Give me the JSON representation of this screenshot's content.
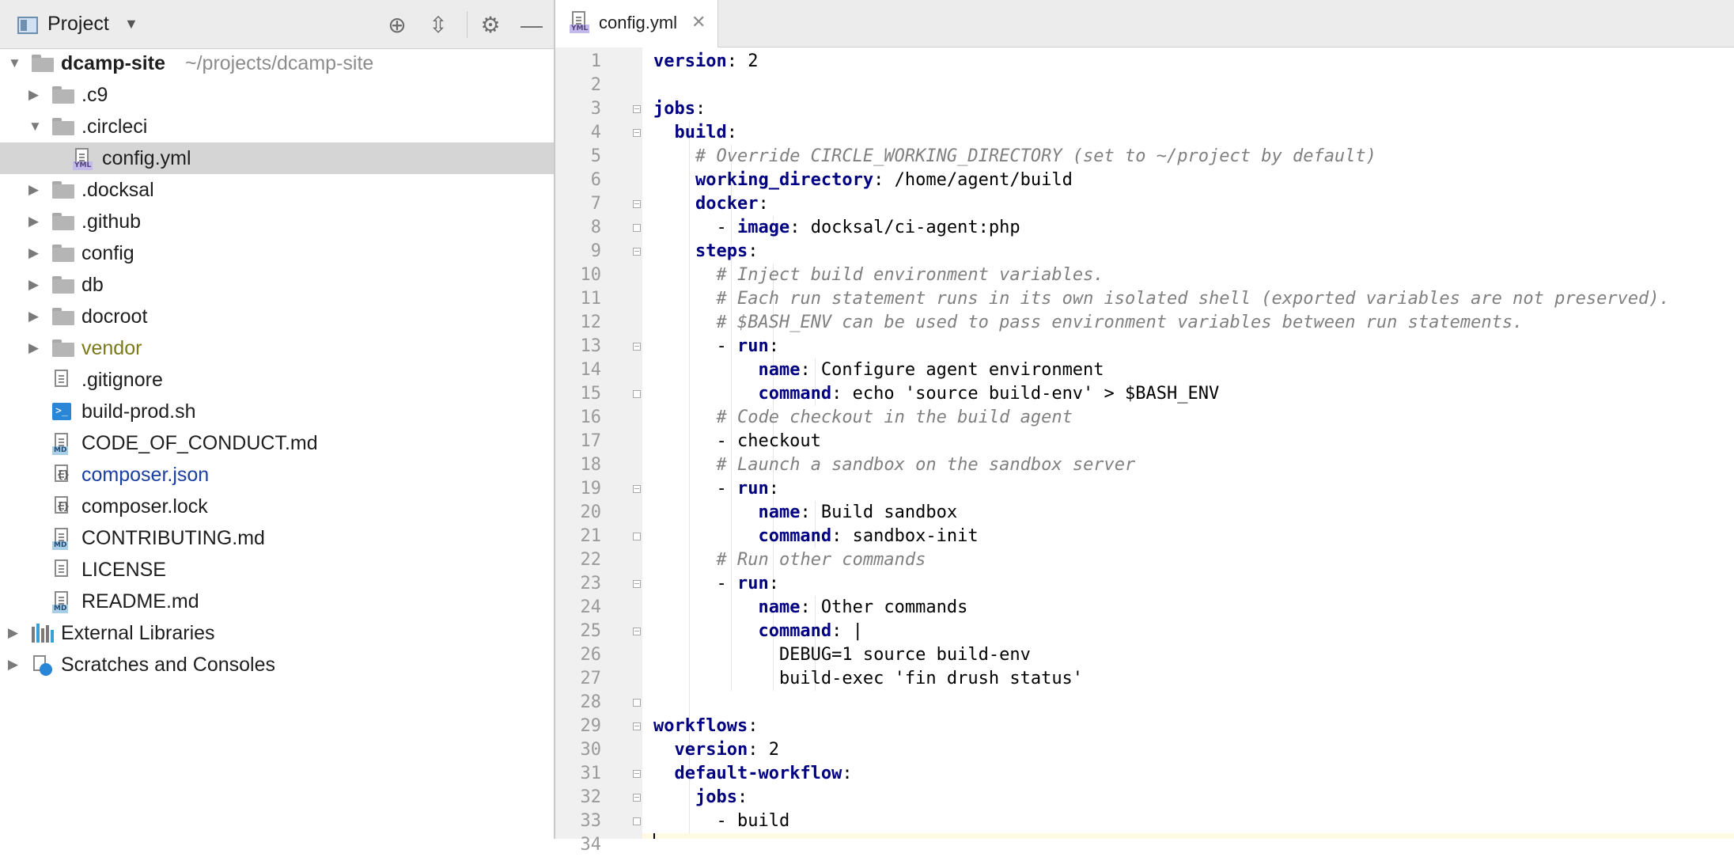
{
  "project_panel": {
    "title": "Project",
    "dropdown": "▼",
    "tools": [
      {
        "name": "locate-icon",
        "glyph": "⊕"
      },
      {
        "name": "collapse-all-icon",
        "glyph": "⇳"
      },
      {
        "name": "gear-icon",
        "glyph": "⚙"
      },
      {
        "name": "minimize-icon",
        "glyph": "—"
      }
    ],
    "tree": [
      {
        "label": "dcamp-site",
        "path": "~/projects/dcamp-site",
        "indent": 0,
        "kind": "folder",
        "arrow": "▼",
        "style": "bold"
      },
      {
        "label": ".c9",
        "indent": 1,
        "kind": "folder",
        "arrow": "▶"
      },
      {
        "label": ".circleci",
        "indent": 1,
        "kind": "folder",
        "arrow": "▼"
      },
      {
        "label": "config.yml",
        "indent": 2,
        "kind": "yml",
        "selected": true
      },
      {
        "label": ".docksal",
        "indent": 1,
        "kind": "folder",
        "arrow": "▶"
      },
      {
        "label": ".github",
        "indent": 1,
        "kind": "folder",
        "arrow": "▶"
      },
      {
        "label": "config",
        "indent": 1,
        "kind": "folder",
        "arrow": "▶"
      },
      {
        "label": "db",
        "indent": 1,
        "kind": "folder",
        "arrow": "▶"
      },
      {
        "label": "docroot",
        "indent": 1,
        "kind": "folder",
        "arrow": "▶"
      },
      {
        "label": "vendor",
        "indent": 1,
        "kind": "folder",
        "arrow": "▶",
        "style": "vendor"
      },
      {
        "label": ".gitignore",
        "indent": 1,
        "kind": "text"
      },
      {
        "label": "build-prod.sh",
        "indent": 1,
        "kind": "shell"
      },
      {
        "label": "CODE_OF_CONDUCT.md",
        "indent": 1,
        "kind": "md"
      },
      {
        "label": "composer.json",
        "indent": 1,
        "kind": "json",
        "style": "link"
      },
      {
        "label": "composer.lock",
        "indent": 1,
        "kind": "json"
      },
      {
        "label": "CONTRIBUTING.md",
        "indent": 1,
        "kind": "md"
      },
      {
        "label": "LICENSE",
        "indent": 1,
        "kind": "text"
      },
      {
        "label": "README.md",
        "indent": 1,
        "kind": "md"
      },
      {
        "label": "External Libraries",
        "indent": 0,
        "kind": "libraries",
        "arrow": "▶"
      },
      {
        "label": "Scratches and Consoles",
        "indent": 0,
        "kind": "scratches",
        "arrow": "▶"
      }
    ]
  },
  "editor": {
    "tab": {
      "label": "config.yml",
      "close": "✕",
      "icon_tag": "YML"
    },
    "lines": [
      [
        [
          "k",
          "version"
        ],
        [
          "t",
          ": 2"
        ]
      ],
      [],
      [
        [
          "k",
          "jobs"
        ],
        [
          "t",
          ":"
        ]
      ],
      [
        [
          "t",
          "  "
        ],
        [
          "k",
          "build"
        ],
        [
          "t",
          ":"
        ]
      ],
      [
        [
          "t",
          "    "
        ],
        [
          "c",
          "# Override CIRCLE_WORKING_DIRECTORY (set to ~/project by default)"
        ]
      ],
      [
        [
          "t",
          "    "
        ],
        [
          "k",
          "working_directory"
        ],
        [
          "t",
          ": /home/agent/build"
        ]
      ],
      [
        [
          "t",
          "    "
        ],
        [
          "k",
          "docker"
        ],
        [
          "t",
          ":"
        ]
      ],
      [
        [
          "t",
          "      - "
        ],
        [
          "k",
          "image"
        ],
        [
          "t",
          ": docksal/ci-agent:php"
        ]
      ],
      [
        [
          "t",
          "    "
        ],
        [
          "k",
          "steps"
        ],
        [
          "t",
          ":"
        ]
      ],
      [
        [
          "t",
          "      "
        ],
        [
          "c",
          "# Inject build environment variables."
        ]
      ],
      [
        [
          "t",
          "      "
        ],
        [
          "c",
          "# Each run statement runs in its own isolated shell (exported variables are not preserved)."
        ]
      ],
      [
        [
          "t",
          "      "
        ],
        [
          "c",
          "# $BASH_ENV can be used to pass environment variables between run statements."
        ]
      ],
      [
        [
          "t",
          "      - "
        ],
        [
          "k",
          "run"
        ],
        [
          "t",
          ":"
        ]
      ],
      [
        [
          "t",
          "          "
        ],
        [
          "k",
          "name"
        ],
        [
          "t",
          ": Configure agent environment"
        ]
      ],
      [
        [
          "t",
          "          "
        ],
        [
          "k",
          "command"
        ],
        [
          "t",
          ": echo 'source build-env' > $BASH_ENV"
        ]
      ],
      [
        [
          "t",
          "      "
        ],
        [
          "c",
          "# Code checkout in the build agent"
        ]
      ],
      [
        [
          "t",
          "      - checkout"
        ]
      ],
      [
        [
          "t",
          "      "
        ],
        [
          "c",
          "# Launch a sandbox on the sandbox server"
        ]
      ],
      [
        [
          "t",
          "      - "
        ],
        [
          "k",
          "run"
        ],
        [
          "t",
          ":"
        ]
      ],
      [
        [
          "t",
          "          "
        ],
        [
          "k",
          "name"
        ],
        [
          "t",
          ": Build sandbox"
        ]
      ],
      [
        [
          "t",
          "          "
        ],
        [
          "k",
          "command"
        ],
        [
          "t",
          ": sandbox-init"
        ]
      ],
      [
        [
          "t",
          "      "
        ],
        [
          "c",
          "# Run other commands"
        ]
      ],
      [
        [
          "t",
          "      - "
        ],
        [
          "k",
          "run"
        ],
        [
          "t",
          ":"
        ]
      ],
      [
        [
          "t",
          "          "
        ],
        [
          "k",
          "name"
        ],
        [
          "t",
          ": Other commands"
        ]
      ],
      [
        [
          "t",
          "          "
        ],
        [
          "k",
          "command"
        ],
        [
          "t",
          ": |"
        ]
      ],
      [
        [
          "t",
          "            DEBUG=1 source build-env"
        ]
      ],
      [
        [
          "t",
          "            build-exec 'fin drush status'"
        ]
      ],
      [],
      [
        [
          "k",
          "workflows"
        ],
        [
          "t",
          ":"
        ]
      ],
      [
        [
          "t",
          "  "
        ],
        [
          "k",
          "version"
        ],
        [
          "t",
          ": 2"
        ]
      ],
      [
        [
          "t",
          "  "
        ],
        [
          "k",
          "default-workflow"
        ],
        [
          "t",
          ":"
        ]
      ],
      [
        [
          "t",
          "    "
        ],
        [
          "k",
          "jobs"
        ],
        [
          "t",
          ":"
        ]
      ],
      [
        [
          "t",
          "      - build"
        ]
      ],
      []
    ],
    "fold_open_lines": [
      3,
      4,
      7,
      9,
      13,
      19,
      23,
      25,
      29,
      31,
      32
    ],
    "fold_close_lines": [
      8,
      15,
      21,
      28,
      33
    ],
    "cursor_line": 34
  }
}
